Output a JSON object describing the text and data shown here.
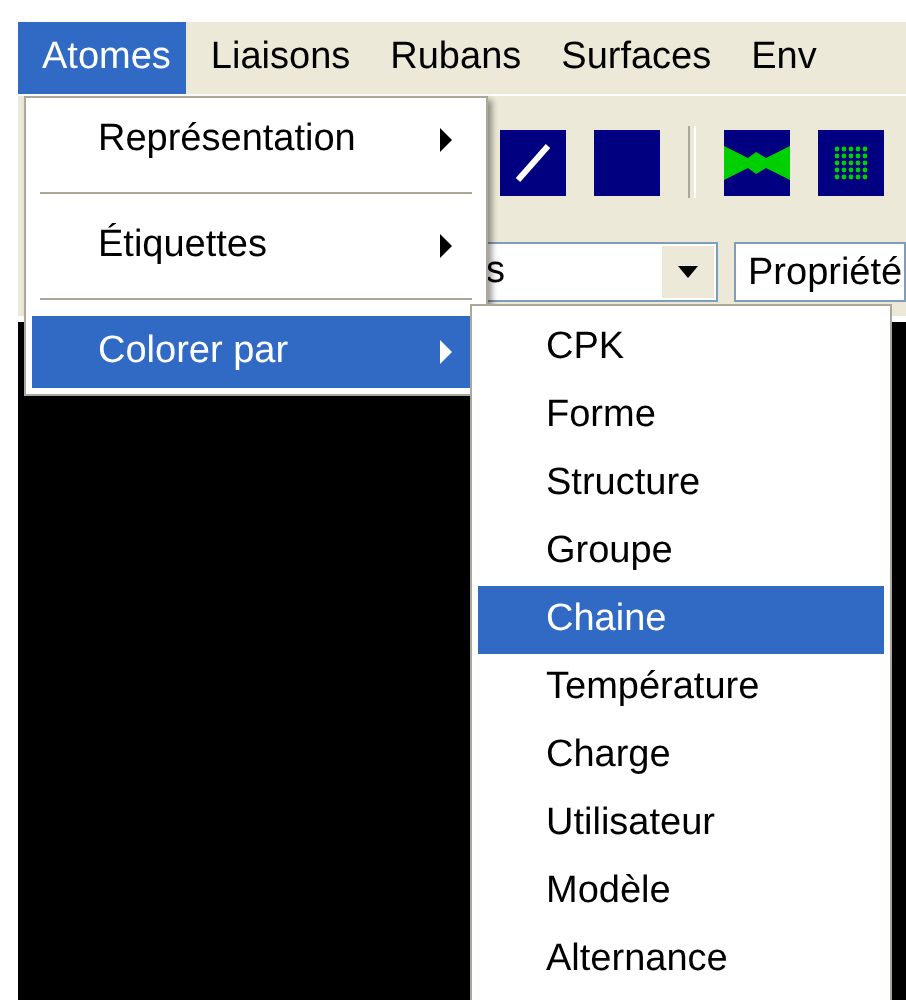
{
  "menubar": [
    {
      "label": "Atomes",
      "selected": true
    },
    {
      "label": "Liaisons",
      "selected": false
    },
    {
      "label": "Rubans",
      "selected": false
    },
    {
      "label": "Surfaces",
      "selected": false
    },
    {
      "label": "Env",
      "selected": false
    }
  ],
  "toolbar": [
    {
      "kind": "line"
    },
    {
      "kind": "square"
    },
    {
      "kind": "separator"
    },
    {
      "kind": "ribbon"
    },
    {
      "kind": "dots"
    }
  ],
  "selection_combo": {
    "value": "s"
  },
  "property_field": {
    "value": "Propriété"
  },
  "menu": {
    "items": [
      {
        "kind": "submenu",
        "label": "Représentation",
        "selected": false
      },
      {
        "kind": "separator"
      },
      {
        "kind": "submenu",
        "label": "Étiquettes",
        "selected": false
      },
      {
        "kind": "separator"
      },
      {
        "kind": "submenu",
        "label": "Colorer par",
        "selected": true
      }
    ]
  },
  "submenu": {
    "items": [
      {
        "label": "CPK",
        "selected": false
      },
      {
        "label": "Forme",
        "selected": false
      },
      {
        "label": "Structure",
        "selected": false
      },
      {
        "label": "Groupe",
        "selected": false
      },
      {
        "label": "Chaine",
        "selected": true
      },
      {
        "label": "Température",
        "selected": false
      },
      {
        "label": "Charge",
        "selected": false
      },
      {
        "label": "Utilisateur",
        "selected": false
      },
      {
        "label": "Modèle",
        "selected": false
      },
      {
        "label": "Alternance",
        "selected": false
      }
    ]
  }
}
